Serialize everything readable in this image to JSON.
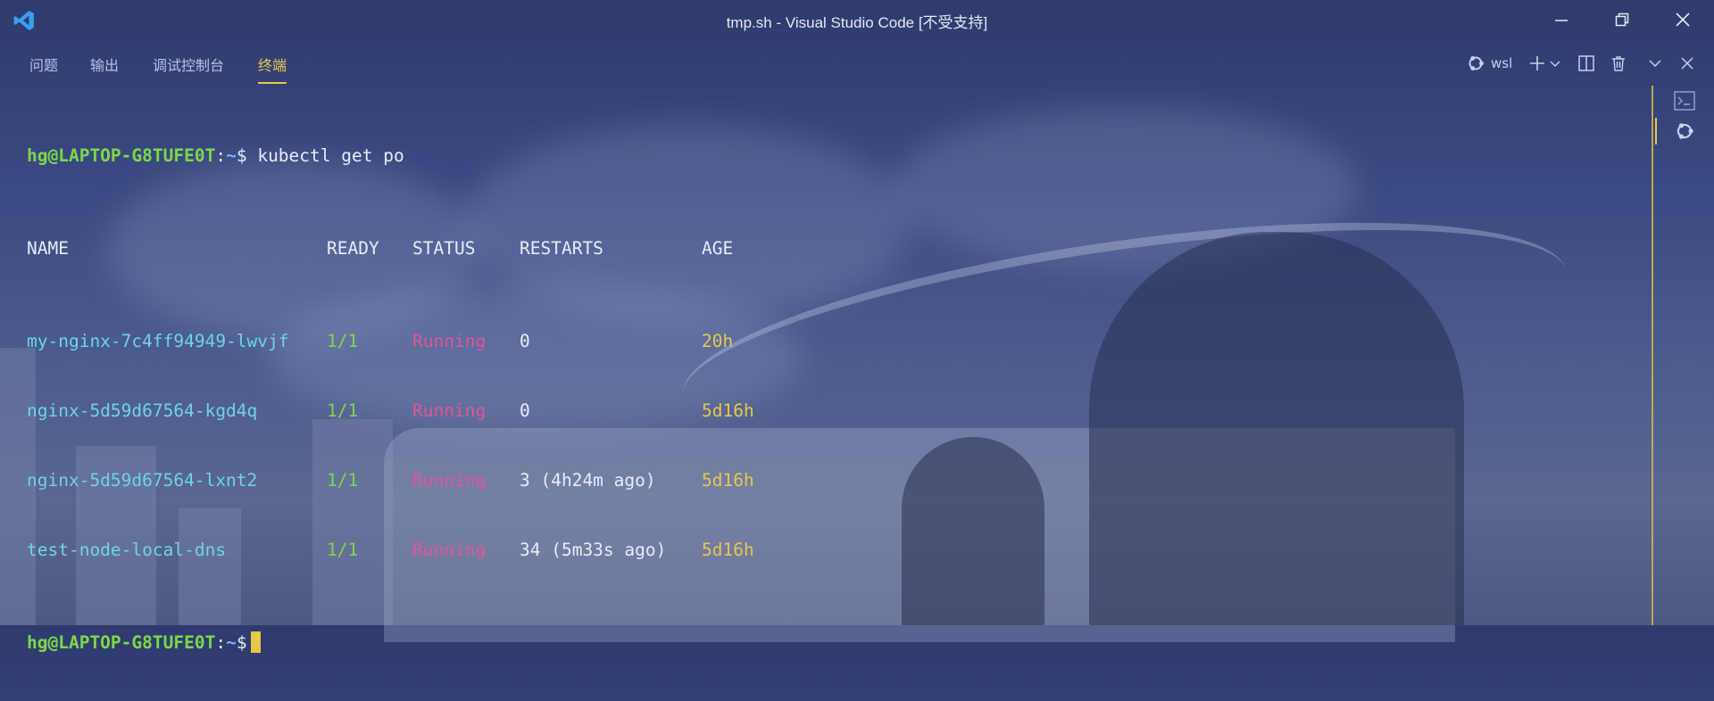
{
  "window": {
    "title": "tmp.sh - Visual Studio Code [不受支持]",
    "minimize_label": "—",
    "restore_label": "❐",
    "close_label": "✕"
  },
  "panel": {
    "tabs": [
      {
        "label": "问题",
        "active": false
      },
      {
        "label": "输出",
        "active": false
      },
      {
        "label": "调试控制台",
        "active": false
      },
      {
        "label": "终端",
        "active": true
      }
    ],
    "terminal_profile": "wsl",
    "accent_color": "#e6c84a"
  },
  "terminal": {
    "prompt": {
      "user_host": "hg@LAPTOP-G8TUFE0T",
      "path": "~",
      "symbol": "$"
    },
    "command": "kubectl get po",
    "columns": [
      "NAME",
      "READY",
      "STATUS",
      "RESTARTS",
      "AGE"
    ],
    "rows": [
      {
        "name": "my-nginx-7c4ff94949-lwvjf",
        "ready": "1/1",
        "status": "Running",
        "restarts": "0",
        "age": "20h"
      },
      {
        "name": "nginx-5d59d67564-kgd4q",
        "ready": "1/1",
        "status": "Running",
        "restarts": "0",
        "age": "5d16h"
      },
      {
        "name": "nginx-5d59d67564-lxnt2",
        "ready": "1/1",
        "status": "Running",
        "restarts": "3 (4h24m ago)",
        "age": "5d16h"
      },
      {
        "name": "test-node-local-dns",
        "ready": "1/1",
        "status": "Running",
        "restarts": "34 (5m33s ago)",
        "age": "5d16h"
      }
    ]
  }
}
